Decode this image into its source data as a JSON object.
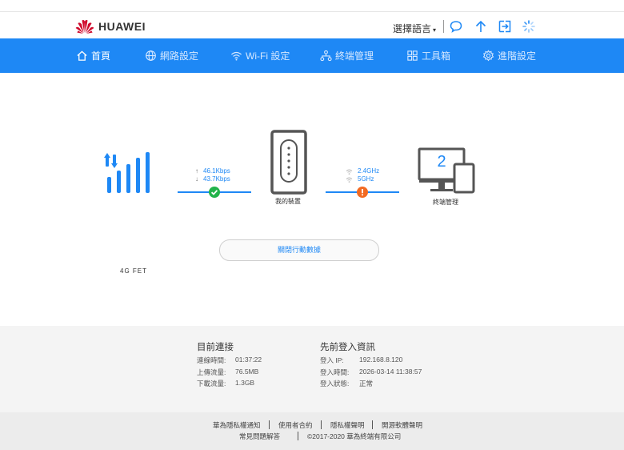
{
  "brand": {
    "name": "HUAWEI",
    "color": "#cf0a2c"
  },
  "header": {
    "language_label": "選擇語言",
    "icons": [
      "chat-icon",
      "upload-icon",
      "logout-icon",
      "loading-icon"
    ]
  },
  "colors": {
    "accent": "#1e88f5",
    "ok": "#22b34b",
    "warn": "#f26a22"
  },
  "nav": {
    "items": [
      {
        "label": "首頁",
        "icon": "home-icon",
        "active": true
      },
      {
        "label": "網路設定",
        "icon": "globe-icon"
      },
      {
        "label": "Wi-Fi 設定",
        "icon": "wifi-icon"
      },
      {
        "label": "終端管理",
        "icon": "devices-icon"
      },
      {
        "label": "工具箱",
        "icon": "toolbox-icon"
      },
      {
        "label": "進階設定",
        "icon": "gear-icon"
      }
    ]
  },
  "status": {
    "network_label": "4G  FET",
    "upload_rate": "46.1Kbps",
    "download_rate": "43.7Kbps",
    "device_label": "我的裝置",
    "wifi_24": "2.4GHz",
    "wifi_5": "5GHz",
    "terminal_count": "2",
    "terminal_label": "終端管理",
    "data_button": "關閉行動數據"
  },
  "current_connection": {
    "title": "目前連接",
    "rows": [
      {
        "label": "連線時間:",
        "value": "01:37:22"
      },
      {
        "label": "上傳流量:",
        "value": "76.5MB"
      },
      {
        "label": "下載流量:",
        "value": "1.3GB"
      }
    ]
  },
  "previous_login": {
    "title": "先前登入資訊",
    "rows": [
      {
        "label": "登入 IP:",
        "value": "192.168.8.120"
      },
      {
        "label": "登入時間:",
        "value": "2026-03-14 11:38:57"
      },
      {
        "label": "登入狀態:",
        "value": "正常"
      }
    ]
  },
  "footer": {
    "links": [
      "華為隱私權通知",
      "使用者合約",
      "隱私權聲明",
      "開源軟體聲明"
    ],
    "faq": "常見問題解答",
    "copyright": "©2017-2020 華為終端有限公司"
  }
}
